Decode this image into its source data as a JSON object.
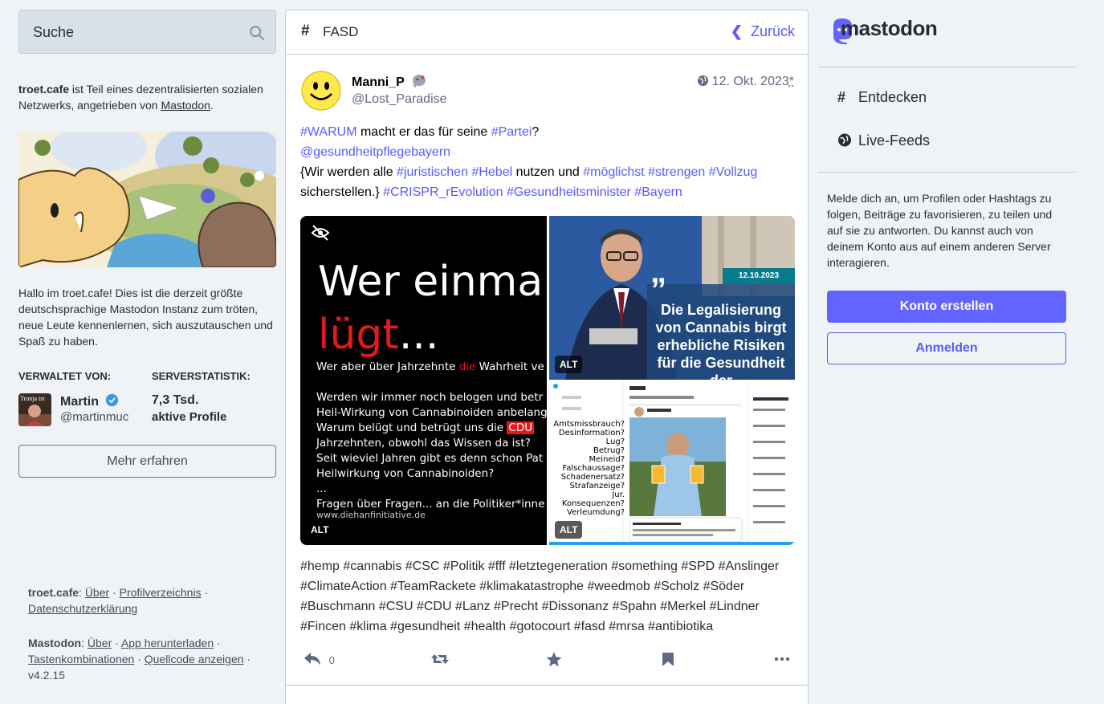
{
  "search": {
    "placeholder": "Suche"
  },
  "about": {
    "server": "troet.cafe",
    "text_mid": " ist Teil eines dezentralisierten sozialen Netzwerks, angetrieben von ",
    "link": "Mastodon",
    "text_end": "."
  },
  "welcome": "Hallo im troet.cafe! Dies ist die derzeit größte deutschsprachige Mastodon Instanz zum tröten, neue Leute kennenlernen, sich auszutauschen und Spaß zu haben.",
  "admin": {
    "heading": "VERWALTET VON:",
    "name": "Martin",
    "handle": "@martinmuc",
    "avatar_text": "Tronja ist"
  },
  "stats": {
    "heading": "SERVERSTATISTIK:",
    "value": "7,3 Tsd.",
    "label": "aktive Profile"
  },
  "learn_more": "Mehr erfahren",
  "footer": {
    "server_label": "troet.cafe",
    "server_links": [
      "Über",
      "Profilverzeichnis",
      "Datenschutzerklärung"
    ],
    "mastodon_label": "Mastodon",
    "mastodon_links": [
      "Über",
      "App herunterladen",
      "Tastenkombinationen",
      "Quellcode anzeigen"
    ],
    "version": "v4.2.15"
  },
  "column": {
    "hash": "#",
    "title": "FASD",
    "back": "Zurück"
  },
  "status": {
    "display_name": "Manni_P",
    "acct": "@Lost_Paradise",
    "date": "12. Okt. 2023",
    "edited_mark": "*",
    "content": {
      "l1_tag1": "#WARUM",
      "l1_text": " macht er das für seine ",
      "l1_tag2": "#Partei",
      "l1_end": "?",
      "mention": "@gesundheitpflegebayern",
      "l3_a": "{Wir werden alle ",
      "t_jur": "#juristischen",
      "t_heb": "#Hebel",
      "l3_b": " nutzen und ",
      "t_mog": "#möglichst",
      "t_str": "#strengen",
      "t_voll": "#Vollzug",
      "l4_a": "sicherstellen.} ",
      "t_crispr": "#CRISPR_rEvolution",
      "t_gm": "#Gesundheitsminister",
      "t_bay": "#Bayern"
    },
    "media": {
      "alt_label": "ALT",
      "img1": {
        "line1": "Wer einma",
        "line2": "lügt",
        "line2_dots": "...",
        "text_a": "Wer aber über Jahrzehnte ",
        "text_a_red": "die",
        "text_a_end": " Wahrheit ve",
        "text_b": "Werden wir immer noch belogen und betr",
        "text_c": "Heil-Wirkung von Cannabinoiden anbelang",
        "text_d": "Warum belügt und betrügt uns die ",
        "text_d_red": "CDU",
        "text_e": "Jahrzehnten, obwohl das Wissen da ist?",
        "text_f": "Seit wieviel Jahren gibt es denn schon Pat",
        "text_g": "Heilwirkung von Cannabinoiden?",
        "text_h": "...",
        "text_i": "Fragen über Fragen... an die Politiker*inne",
        "url": "www.diehanfinitiative.de"
      },
      "img2": {
        "date": "12.10.2023",
        "quote": "Die Legalisierung von Cannabis birgt erhebliche Risiken für die Gesundheit der"
      },
      "img3": {
        "questions": [
          "Amtsmissbrauch?",
          "Desinformation?",
          "Lug?",
          "Betrug?",
          "Meineid?",
          "Falschaussage?",
          "Schadenersatz?",
          "Strafanzeige?",
          "Jur. Konsequenzen?",
          "Verleumdung?"
        ]
      }
    },
    "hashtags": "#hemp #cannabis #CSC #Politik #fff #letztegeneration #something #SPD #Anslinger #ClimateAction #TeamRackete #klimakatastrophe #weedmob #Scholz #Söder #Buschmann #CSU #CDU #Lanz #Precht #Dissonanz #Spahn #Merkel #Lindner #Fincen #klima #gesundheit #health #gotocourt #fasd #mrsa #antibiotika",
    "reply_count": "0"
  },
  "right": {
    "logo_text": "mastodon",
    "nav": [
      {
        "label": "Entdecken",
        "icon": "hash-icon"
      },
      {
        "label": "Live-Feeds",
        "icon": "globe-icon"
      }
    ],
    "signup_text": "Melde dich an, um Profilen oder Hashtags zu folgen, Beiträge zu favorisieren, zu teilen und auf sie zu antworten. Du kannst auch von deinem Konto aus auf einem anderen Server interagieren.",
    "create_account": "Konto erstellen",
    "login": "Anmelden"
  },
  "colors": {
    "accent": "#595aff",
    "primary_btn": "#6364ff",
    "bg": "#eff3f5"
  }
}
